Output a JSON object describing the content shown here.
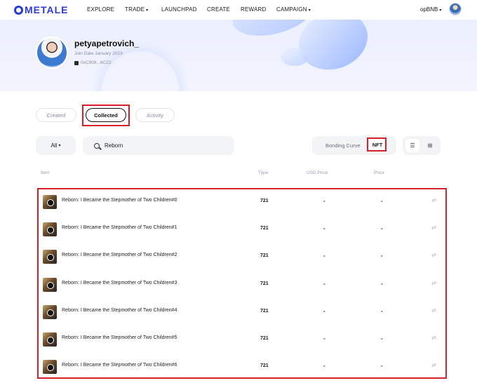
{
  "header": {
    "logo": "METALE",
    "nav": [
      "EXPLORE",
      "TRADE",
      "LAUNCHPAD",
      "CREATE",
      "REWARD",
      "CAMPAIGN"
    ],
    "network": "opBNB"
  },
  "profile": {
    "username": "petyapetrovich_",
    "join_date": "Join Date January 2023",
    "address": "0xC908...6C23"
  },
  "tabs": [
    "Created",
    "Collected",
    "Activity"
  ],
  "filters": {
    "category": "All",
    "search_value": "Reborn",
    "segment_bonding": "Bonding Curve",
    "segment_nft": "NFT"
  },
  "table": {
    "columns": [
      "Item",
      "Type",
      "USD Price",
      "Price"
    ],
    "rows": [
      {
        "name": "Reborn: I Became the Stepmother of Two Children#0",
        "type": "721",
        "usd": "-",
        "price": "-"
      },
      {
        "name": "Reborn: I Became the Stepmother of Two Children#1",
        "type": "721",
        "usd": "-",
        "price": "-"
      },
      {
        "name": "Reborn: I Became the Stepmother of Two Children#2",
        "type": "721",
        "usd": "-",
        "price": "-"
      },
      {
        "name": "Reborn: I Became the Stepmother of Two Children#3",
        "type": "721",
        "usd": "-",
        "price": "-"
      },
      {
        "name": "Reborn: I Became the Stepmother of Two Children#4",
        "type": "721",
        "usd": "-",
        "price": "-"
      },
      {
        "name": "Reborn: I Became the Stepmother of Two Children#5",
        "type": "721",
        "usd": "-",
        "price": "-"
      },
      {
        "name": "Reborn: I Became the Stepmother of Two Children#6",
        "type": "721",
        "usd": "-",
        "price": "-"
      }
    ]
  },
  "colors": {
    "accent": "#2b3bd6",
    "highlight": "#d6202a"
  }
}
